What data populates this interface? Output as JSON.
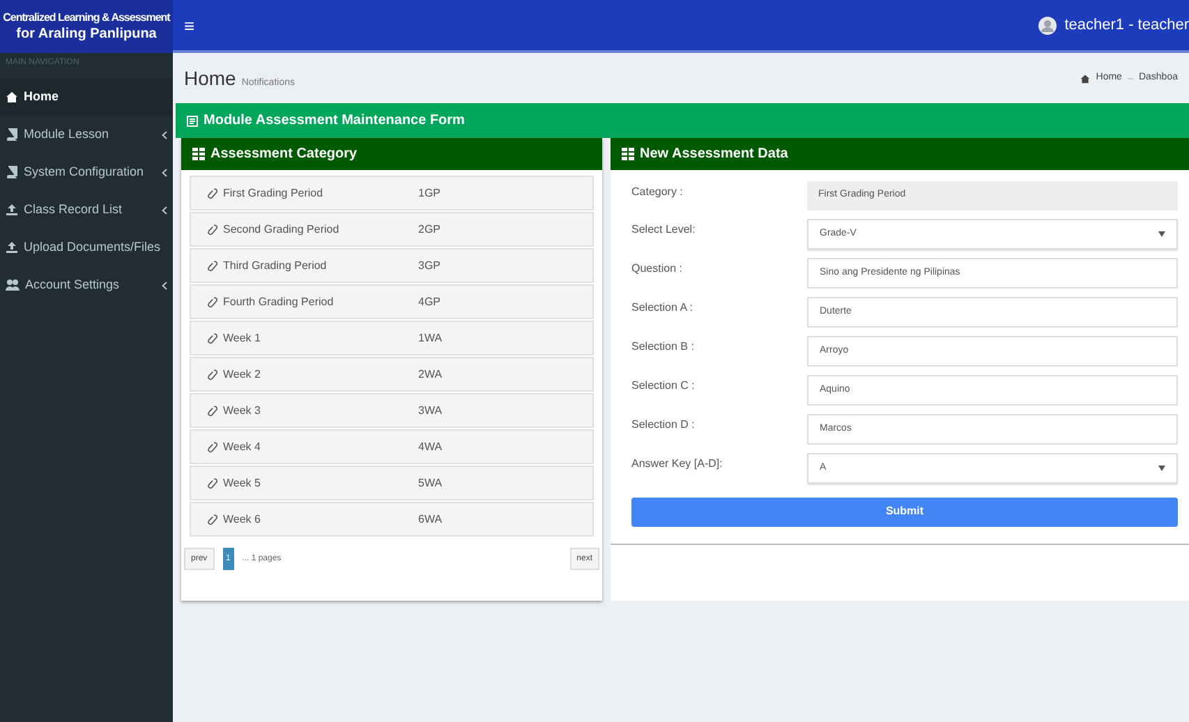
{
  "app_title": {
    "line1": "Centralized Learning & Assessment",
    "line2": "for Araling Panlipuna"
  },
  "menu_toggle": "≡",
  "user": {
    "name": "teacher1 - teacher"
  },
  "sidebar": {
    "header": "MAIN NAVIGATION",
    "items": [
      {
        "label": "Home",
        "selected": true,
        "expandable": false
      },
      {
        "label": "Module Lesson",
        "selected": false,
        "expandable": true
      },
      {
        "label": "System Configuration",
        "selected": false,
        "expandable": true
      },
      {
        "label": "Class Record List",
        "selected": false,
        "expandable": true
      },
      {
        "label": "Upload Documents/Files",
        "selected": false,
        "expandable": false
      },
      {
        "label": "Account Settings",
        "selected": false,
        "expandable": true
      }
    ]
  },
  "page": {
    "title": "Home",
    "subtitle": "Notifications",
    "breadcrumb": [
      "Home",
      "Dashboa"
    ]
  },
  "form_title": "Module Assessment Maintenance Form",
  "category_panel": {
    "title": "Assessment Category",
    "rows": [
      {
        "name": "First Grading Period",
        "code": "1GP"
      },
      {
        "name": "Second Grading Period",
        "code": "2GP"
      },
      {
        "name": "Third Grading Period",
        "code": "3GP"
      },
      {
        "name": "Fourth Grading Period",
        "code": "4GP"
      },
      {
        "name": "Week 1",
        "code": "1WA"
      },
      {
        "name": "Week 2",
        "code": "2WA"
      },
      {
        "name": "Week 3",
        "code": "3WA"
      },
      {
        "name": "Week 4",
        "code": "4WA"
      },
      {
        "name": "Week 5",
        "code": "5WA"
      },
      {
        "name": "Week 6",
        "code": "6WA"
      }
    ],
    "pagination": {
      "prev": "prev",
      "pages": [
        {
          "label": "1",
          "selected": true
        }
      ],
      "info": "... 1 pages",
      "next": "next"
    }
  },
  "data_panel": {
    "title": "New Assessment Data",
    "fields": [
      {
        "label": "Category :",
        "kind": "readonly",
        "value": "First Grading Period"
      },
      {
        "label": "Select Level:",
        "kind": "select",
        "value": "Grade-V"
      },
      {
        "label": "Question :",
        "kind": "text",
        "value": "Sino ang Presidente ng Pilipinas"
      },
      {
        "label": "Selection A :",
        "kind": "text",
        "value": "Duterte"
      },
      {
        "label": "Selection B :",
        "kind": "text",
        "value": "Arroyo"
      },
      {
        "label": "Selection C :",
        "kind": "text",
        "value": "Aquino"
      },
      {
        "label": "Selection D :",
        "kind": "text",
        "value": "Marcos"
      },
      {
        "label": "Answer Key [A-D]:",
        "kind": "select",
        "value": "A"
      }
    ],
    "submit": "Submit"
  }
}
